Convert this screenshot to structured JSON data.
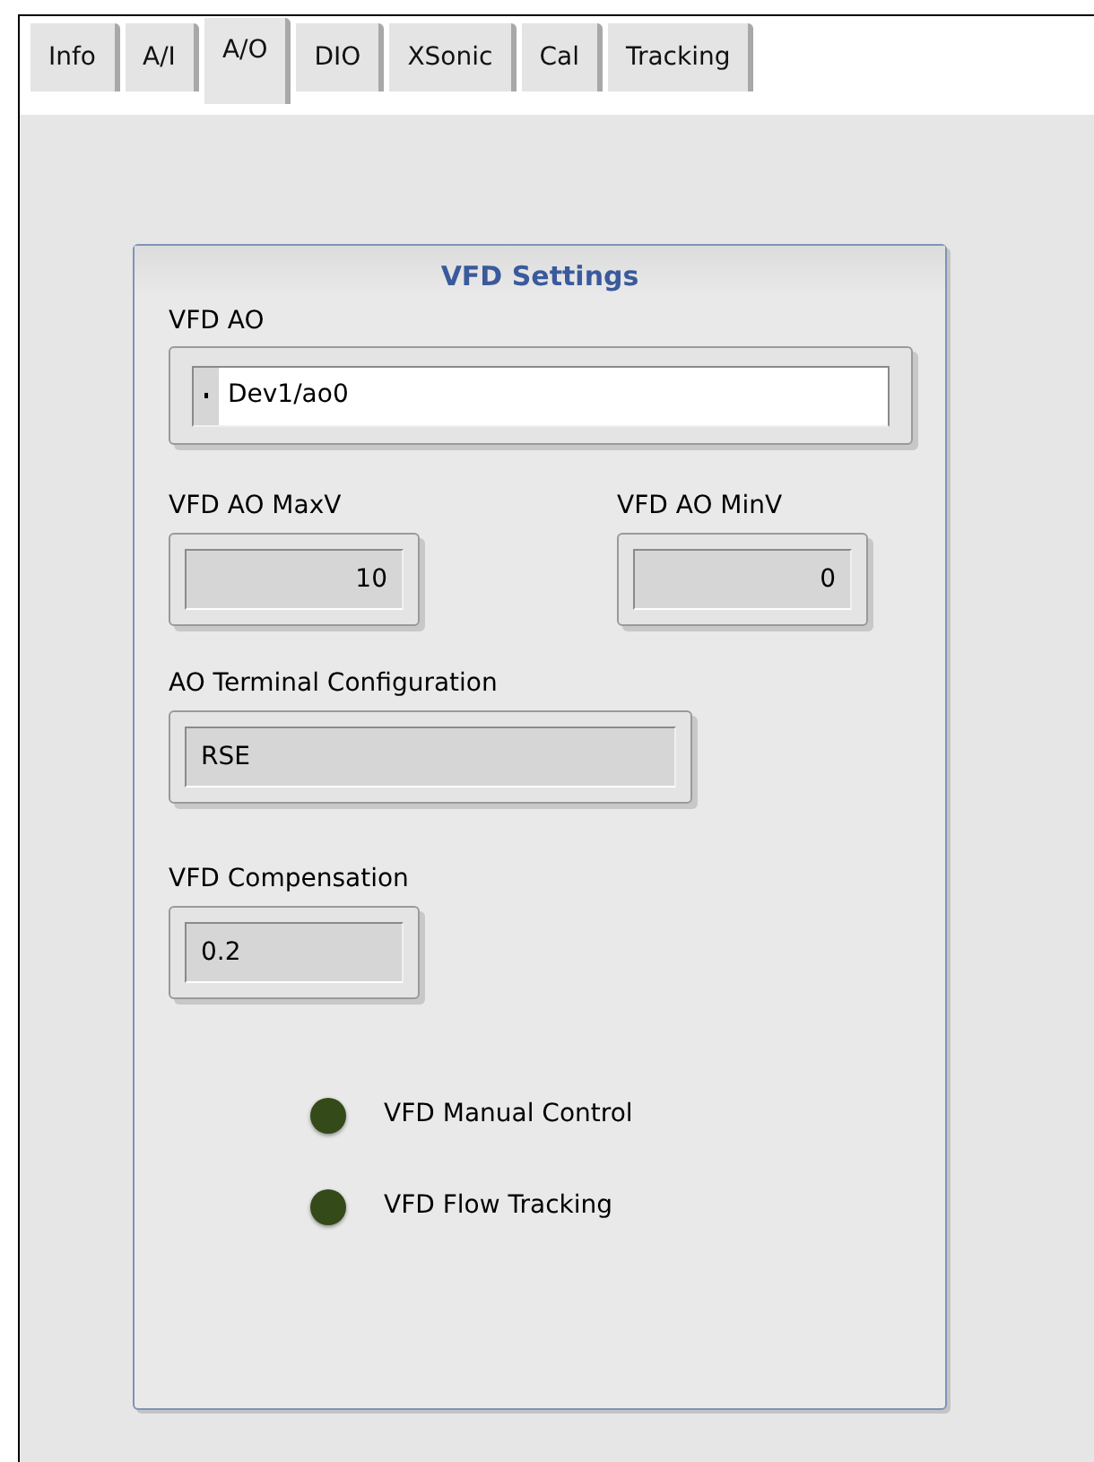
{
  "tabs": [
    {
      "label": "Info",
      "selected": false
    },
    {
      "label": "A/I",
      "selected": false
    },
    {
      "label": "A/O",
      "selected": true
    },
    {
      "label": "DIO",
      "selected": false
    },
    {
      "label": "XSonic",
      "selected": false
    },
    {
      "label": "Cal",
      "selected": false
    },
    {
      "label": "Tracking",
      "selected": false
    }
  ],
  "group": {
    "title": "VFD Settings",
    "vfd_ao": {
      "label": "VFD AO",
      "value": "Dev1/ao0"
    },
    "max_v": {
      "label": "VFD AO MaxV",
      "value": "10"
    },
    "min_v": {
      "label": "VFD AO MinV",
      "value": "0"
    },
    "terminal_config": {
      "label": "AO Terminal Configuration",
      "value": "RSE"
    },
    "compensation": {
      "label": "VFD Compensation",
      "value": "0.2"
    },
    "indicators": [
      {
        "label": "VFD Manual Control",
        "on": false
      },
      {
        "label": "VFD Flow Tracking",
        "on": false
      }
    ]
  }
}
